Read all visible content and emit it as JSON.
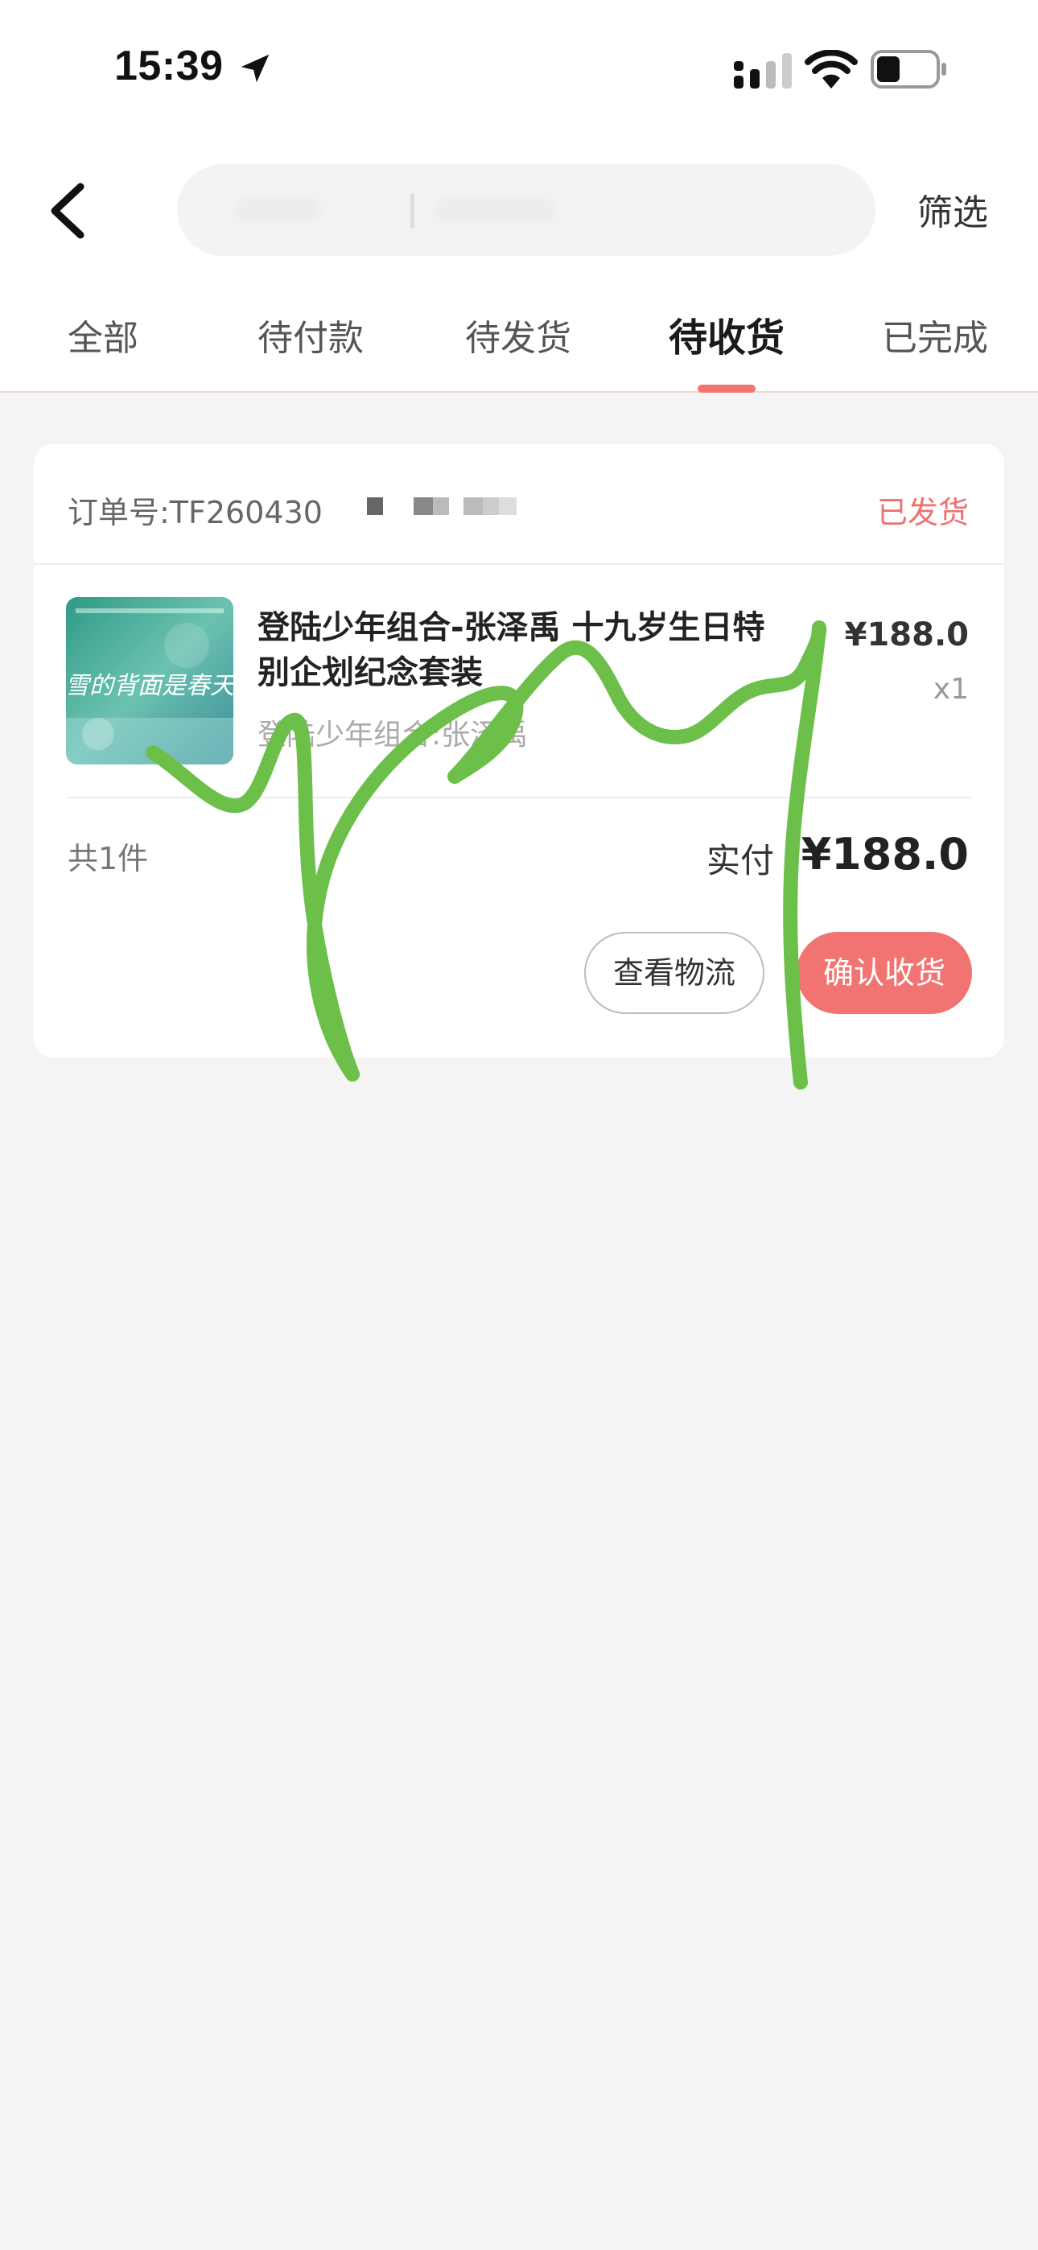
{
  "status_bar": {
    "time": "15:39"
  },
  "header": {
    "filter_label": "筛选"
  },
  "tabs": [
    {
      "label": "全部",
      "active": false
    },
    {
      "label": "待付款",
      "active": false
    },
    {
      "label": "待发货",
      "active": false
    },
    {
      "label": "待收货",
      "active": true
    },
    {
      "label": "已完成",
      "active": false
    }
  ],
  "order": {
    "order_no": "订单号:TF260430",
    "status": "已发货",
    "product": {
      "title": "登陆少年组合-张泽禹 十九岁生日特别企划纪念套装",
      "subtitle": "登陆少年组合:张泽禹",
      "cover_text": "雪的背面是春天",
      "unit_price": "¥188.0",
      "quantity": "x1"
    },
    "count_text": "共1件",
    "paid_label": "实付",
    "paid_amount": "¥188.0",
    "buttons": {
      "logistics": "查看物流",
      "confirm": "确认收货"
    }
  },
  "colors": {
    "accent": "#f27472",
    "status_red": "#f07070",
    "scribble_green": "#6cc04a",
    "background": "#f4f4f4"
  }
}
